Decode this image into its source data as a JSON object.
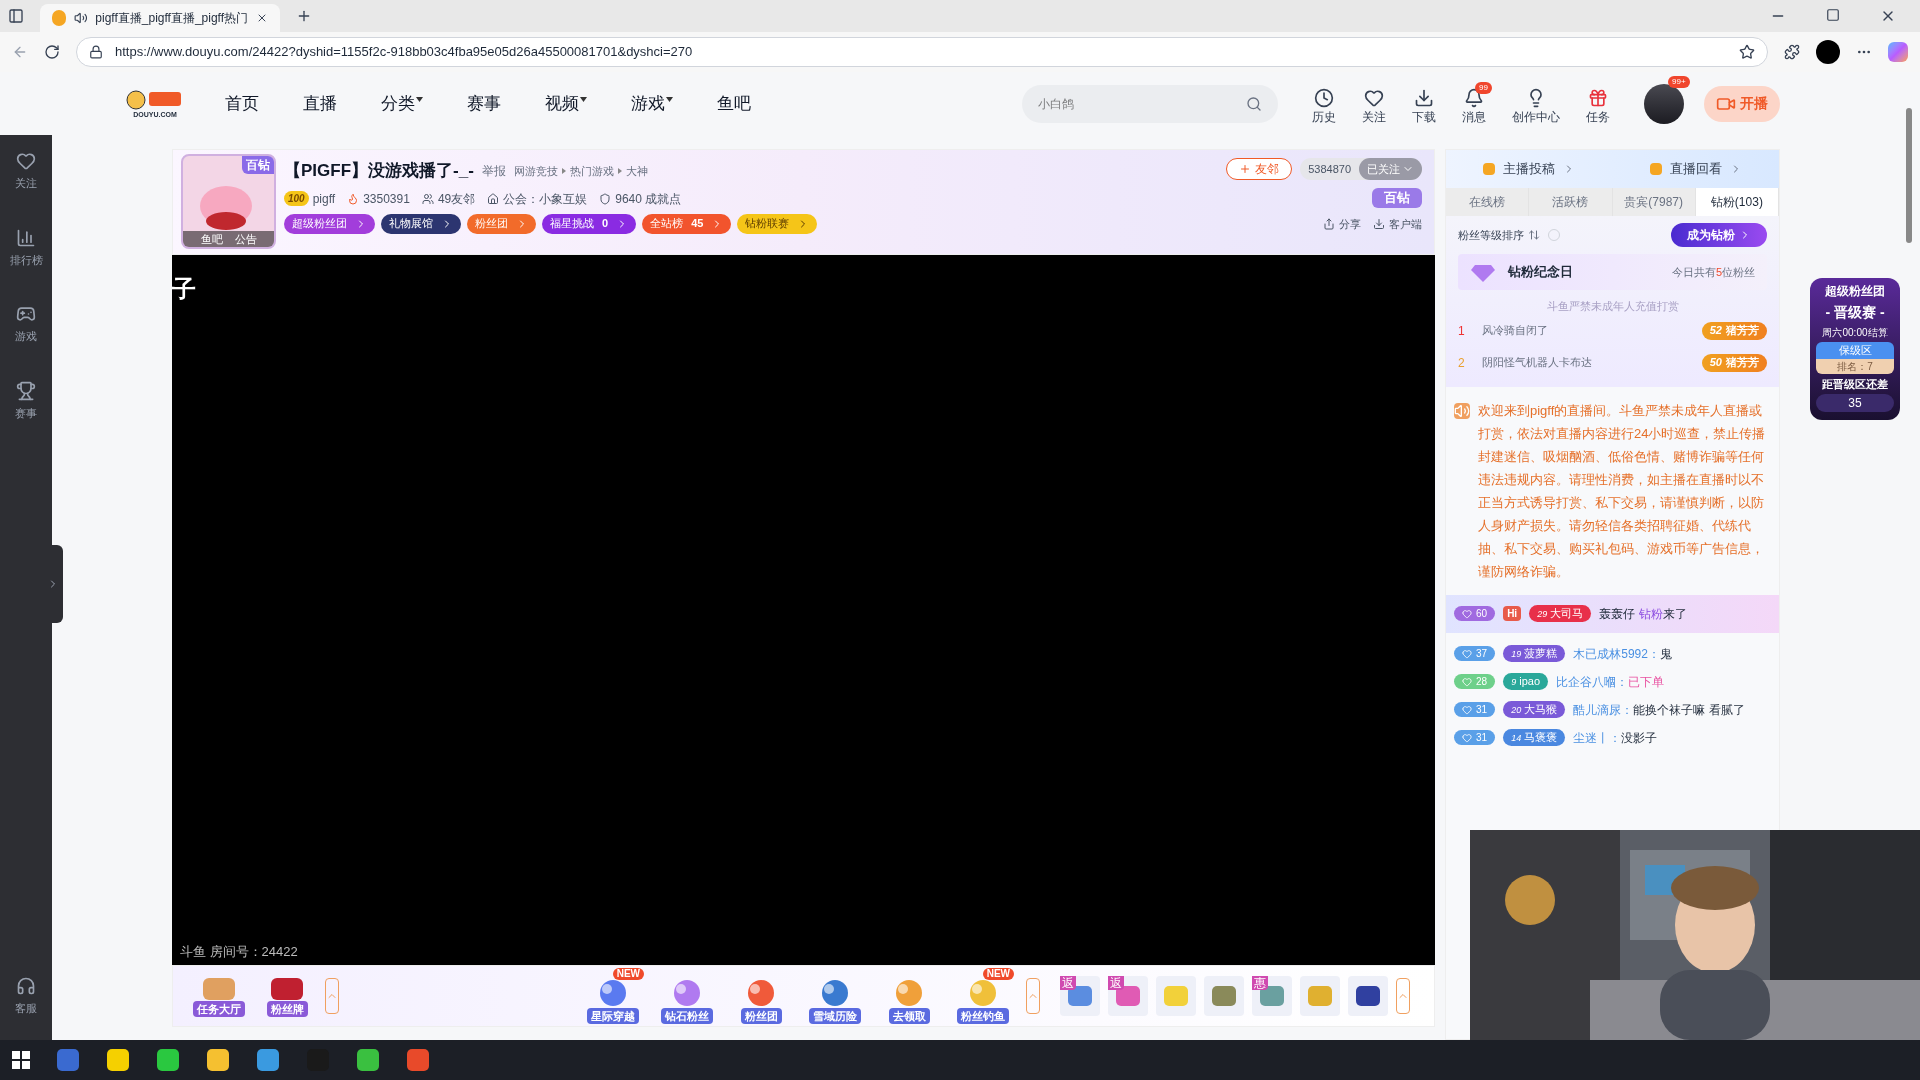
{
  "browser": {
    "tab_title": "pigff直播_pigff直播_pigff热门",
    "url": "https://www.douyu.com/24422?dyshid=1155f2c-918bb03c4fba95e05d26a45500081701&dyshci=270"
  },
  "site": {
    "logo_text": "DOUYU.COM",
    "nav": [
      {
        "label": "首页",
        "dropdown": false
      },
      {
        "label": "直播",
        "dropdown": false
      },
      {
        "label": "分类",
        "dropdown": true
      },
      {
        "label": "赛事",
        "dropdown": false
      },
      {
        "label": "视频",
        "dropdown": true
      },
      {
        "label": "游戏",
        "dropdown": true
      },
      {
        "label": "鱼吧",
        "dropdown": false
      }
    ],
    "search": {
      "placeholder": "小白鸽"
    },
    "tools": [
      {
        "kind": "history",
        "label": "历史"
      },
      {
        "kind": "follow",
        "label": "关注"
      },
      {
        "kind": "download",
        "label": "下载"
      },
      {
        "kind": "message",
        "label": "消息",
        "badge": "99"
      },
      {
        "kind": "creator",
        "label": "创作中心"
      },
      {
        "kind": "task",
        "label": "任务"
      }
    ],
    "avatar_badge": "99+",
    "live_button": "开播"
  },
  "sidebar": {
    "items": [
      {
        "kind": "follow",
        "label": "关注"
      },
      {
        "kind": "rank",
        "label": "排行榜"
      },
      {
        "kind": "game",
        "label": "游戏"
      },
      {
        "kind": "match",
        "label": "赛事"
      }
    ],
    "service": "客服"
  },
  "room": {
    "tier": "百钻",
    "avatar_tabs": [
      "鱼吧",
      "公告"
    ],
    "title": "【PIGFF】没游戏播了-_-",
    "report": "举报",
    "breadcrumbs": [
      "网游竞技",
      "热门游戏",
      "大神"
    ],
    "level": "100",
    "anchor": "pigff",
    "heat": "3350391",
    "friends": "49友邻",
    "guild": "公会：小象互娱",
    "achievement": "9640 成就点",
    "pills": [
      {
        "label": "超级粉丝团",
        "color": "#a23ddb"
      },
      {
        "label": "礼物展馆",
        "color": "#2c3570"
      },
      {
        "label": "粉丝团",
        "color": "#f26b2a"
      },
      {
        "label": "福星挑战",
        "value": "0",
        "color": "#8a2be2"
      },
      {
        "label": "全站榜",
        "value": "45",
        "color": "#f2542d"
      },
      {
        "label": "钻粉联赛",
        "color": "#f5c518"
      }
    ],
    "friend_button": "友邻",
    "followers": "5384870",
    "follow_state": "已关注",
    "tier_badge": "百钻",
    "share": "分享",
    "client": "客户端"
  },
  "video": {
    "caption": "子",
    "room_number": "斗鱼 房间号：24422"
  },
  "gift_bar": {
    "left": [
      {
        "label": "任务大厅"
      },
      {
        "label": "粉丝牌"
      }
    ],
    "activities": [
      {
        "label": "星际穿越",
        "badge": "NEW"
      },
      {
        "label": "钻石粉丝"
      },
      {
        "label": "粉丝团"
      },
      {
        "label": "雪域历险"
      },
      {
        "label": "去领取"
      },
      {
        "label": "粉丝钓鱼",
        "badge": "NEW"
      }
    ],
    "gifts": [
      {
        "tag": "返",
        "color": "#5b8de0"
      },
      {
        "tag": "返",
        "color": "#e05bb4"
      },
      {
        "color": "#f2d13a"
      },
      {
        "color": "#8a8a5a"
      },
      {
        "tag": "惠",
        "color": "#6aa0a0"
      },
      {
        "color": "#e0b030"
      },
      {
        "color": "#3040a0"
      }
    ]
  },
  "panel": {
    "links": [
      "主播投稿",
      "直播回看"
    ],
    "tabs": [
      {
        "label": "在线榜",
        "selected": false
      },
      {
        "label": "活跃榜",
        "selected": false
      },
      {
        "label": "贵宾(7987)",
        "selected": false
      },
      {
        "label": "钻粉(103)",
        "selected": true
      }
    ],
    "sort_label": "粉丝等级排序",
    "become_button": "成为钻粉",
    "anniversary": {
      "title": "钻粉纪念日",
      "note": [
        {
          "text": "今日共有",
          "highlight": false
        },
        {
          "text": "5",
          "highlight": true
        },
        {
          "text": "位粉丝",
          "highlight": false
        }
      ]
    },
    "watermark": "斗鱼严禁未成年人充值打赏",
    "ranking": [
      {
        "rank": "1",
        "name": "风冷骑自闭了",
        "badge_level": "52",
        "badge_name": "猪芳芳"
      },
      {
        "rank": "2",
        "name": "阴阳怪气机器人卡布达",
        "badge_level": "50",
        "badge_name": "猪芳芳"
      }
    ],
    "notice": "欢迎来到pigff的直播间。斗鱼严禁未成年人直播或打赏，依法对直播内容进行24小时巡查，禁止传播封建迷信、吸烟酗酒、低俗色情、赌博诈骗等任何违法违规内容。请理性消费，如主播在直播时以不正当方式诱导打赏、私下交易，请谨慎判断，以防人身财产损失。请勿轻信各类招聘征婚、代练代抽、私下交易、购买礼包码、游戏币等广告信息，谨防网络诈骗。",
    "entrance": {
      "level": "60",
      "hi": "Hi",
      "badge_level": "29",
      "badge_name": "大司马",
      "user": "轰轰仔",
      "tag": "钻粉",
      "text": "来了"
    },
    "messages": [
      {
        "level_badge": {
          "text": "37",
          "color": "#5aa0e8"
        },
        "fan_badge": {
          "level": "19",
          "name": "菠萝糕",
          "color": "#7a5ad8"
        },
        "user": "木已成林5992：",
        "text": "鬼",
        "highlight": false
      },
      {
        "level_badge": {
          "text": "28",
          "color": "#6ed08a"
        },
        "fan_badge": {
          "level": "9",
          "name": "ipao",
          "color": "#2aa89a"
        },
        "user": "比企谷八嗰：",
        "text": "已下单",
        "highlight": true
      },
      {
        "level_badge": {
          "text": "31",
          "color": "#5aa0e8"
        },
        "fan_badge": {
          "level": "20",
          "name": "大马猴",
          "color": "#7a5ad8"
        },
        "user": "酷儿滴尿：",
        "text": "能换个袜子嘛 看腻了",
        "highlight": false
      },
      {
        "level_badge": {
          "text": "31",
          "color": "#5aa0e8"
        },
        "fan_badge": {
          "level": "14",
          "name": "马褒褒",
          "color": "#4a88e0"
        },
        "user": "尘迷丨：",
        "text": "没影子",
        "highlight": false
      }
    ]
  },
  "widget": {
    "title": "超级粉丝团",
    "stage": "- 晋级赛 -",
    "settle": "周六00:00结算",
    "zone": "保级区",
    "rank": "排名：7",
    "gap_label": "距晋级区还差",
    "gap": "35"
  }
}
